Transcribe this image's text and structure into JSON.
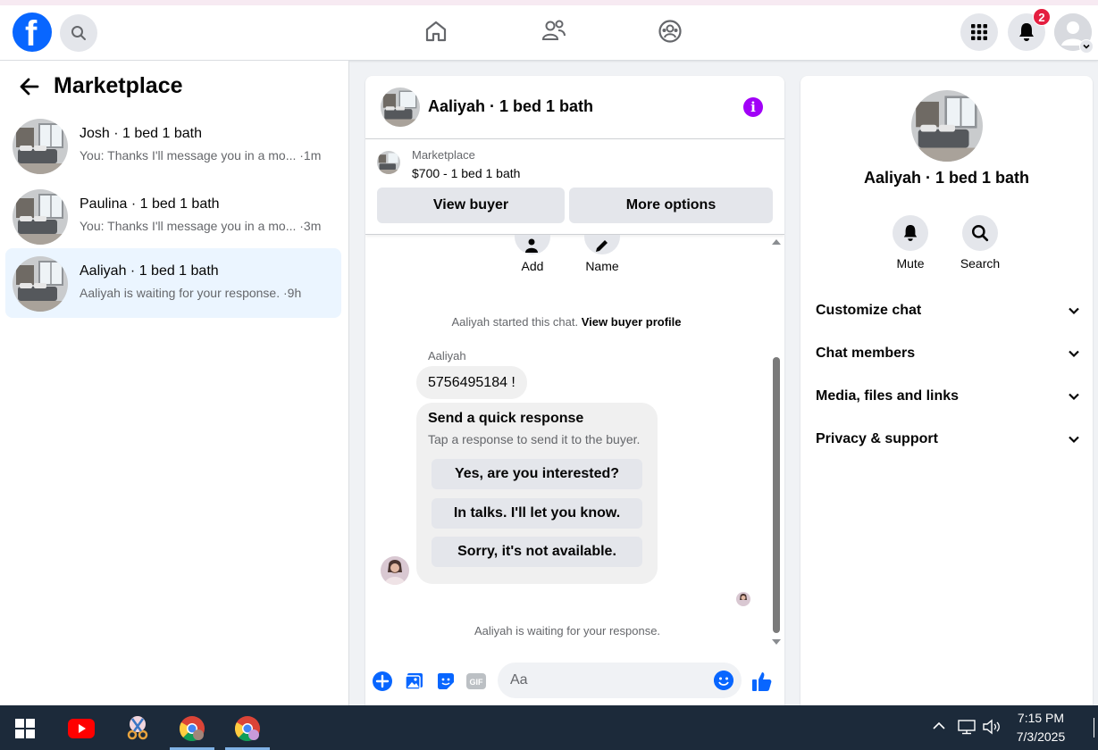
{
  "header": {
    "logo_letter": "f",
    "notification_count": "2"
  },
  "sidebar": {
    "title": "Marketplace",
    "conversations": [
      {
        "name": "Josh · 1 bed 1 bath",
        "snippet": "You: Thanks I'll message you in a mo... ·1m",
        "active": false
      },
      {
        "name": "Paulina · 1 bed 1 bath",
        "snippet": "You: Thanks I'll message you in a mo... ·3m",
        "active": false
      },
      {
        "name": "Aaliyah · 1 bed 1 bath",
        "snippet": "Aaliyah is waiting for your response. ·9h",
        "active": true
      }
    ]
  },
  "chat": {
    "title": "Aaliyah · 1 bed 1 bath",
    "info_glyph": "i",
    "listing": {
      "label": "Marketplace",
      "price_line": "$700 - 1 bed 1 bath",
      "view_buyer": "View buyer",
      "more_options": "More options"
    },
    "actions": [
      {
        "label": "Add",
        "icon": "add-person-icon"
      },
      {
        "label": "Name",
        "icon": "pencil-icon"
      }
    ],
    "started_text": "Aaliyah started this chat.",
    "started_link": "View buyer profile",
    "sender": "Aaliyah",
    "message": "5756495184 !",
    "quick_response": {
      "title": "Send a quick response",
      "subtitle": "Tap a response to send it to the buyer.",
      "options": [
        "Yes, are you interested?",
        "In talks. I'll let you know.",
        "Sorry, it's not available."
      ]
    },
    "waiting_text": "Aaliyah is waiting for your response.",
    "composer": {
      "placeholder": "Aa",
      "gif_label": "GIF"
    }
  },
  "details": {
    "name": "Aaliyah · 1 bed 1 bath",
    "actions": [
      {
        "label": "Mute",
        "icon": "bell-icon"
      },
      {
        "label": "Search",
        "icon": "search-icon"
      }
    ],
    "sections": [
      "Customize chat",
      "Chat members",
      "Media, files and links",
      "Privacy & support"
    ]
  },
  "taskbar": {
    "time": "7:15 PM",
    "date": "7/3/2025"
  },
  "colors": {
    "brand": "#0866ff",
    "active_row": "#ebf5ff",
    "badge": "#e41e3f",
    "info": "#a100f7",
    "taskbar": "#1c2a3a"
  }
}
